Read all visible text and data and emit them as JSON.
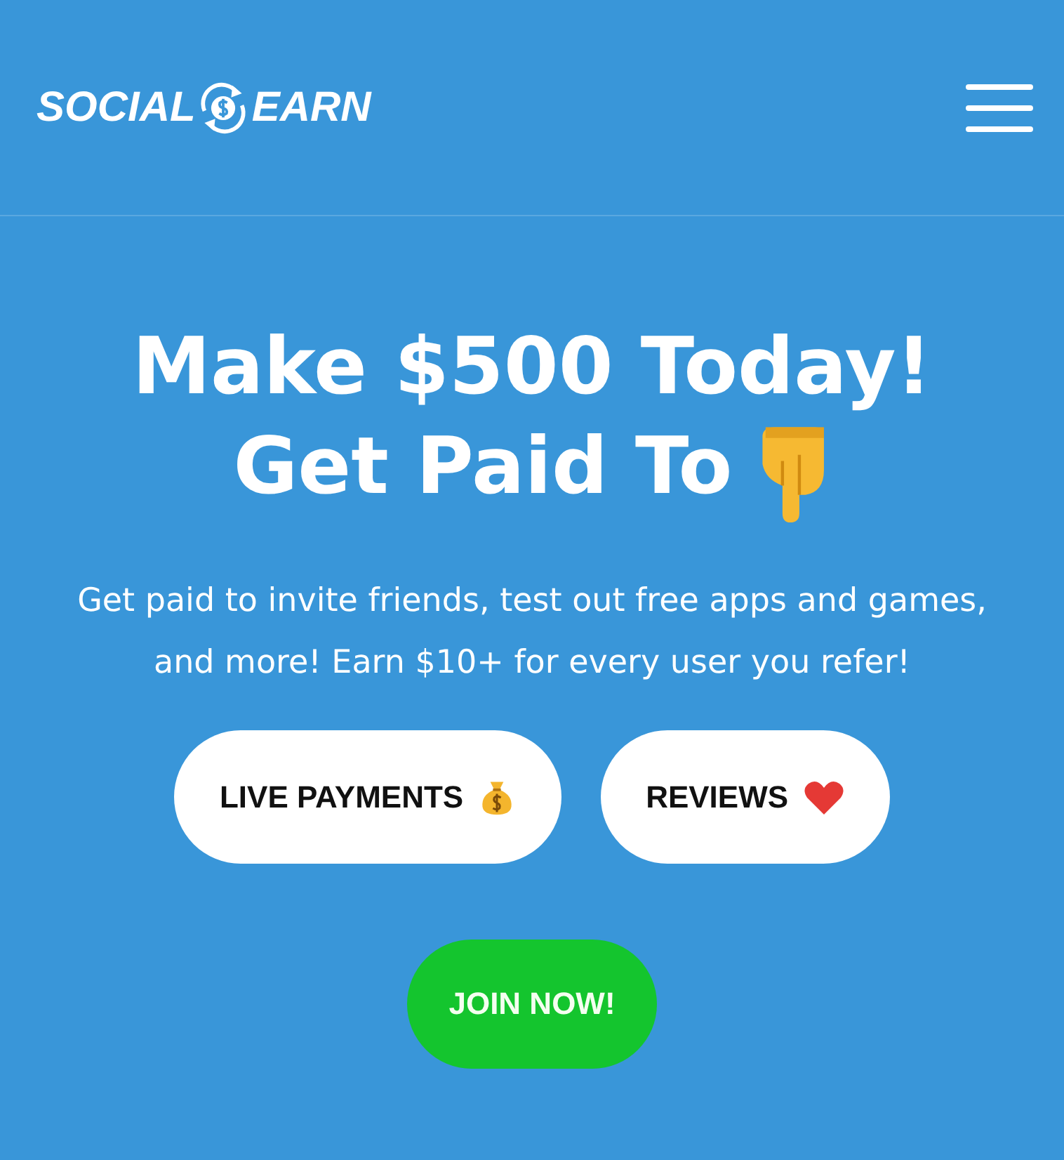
{
  "header": {
    "logo": {
      "left": "SOCIAL",
      "right": "EARN"
    }
  },
  "hero": {
    "headline": [
      "Make $500 Today!",
      "Get Paid To"
    ],
    "description": "Get paid to invite friends, test out free apps and games, and more! Earn $10+ for every user you refer!",
    "buttons": [
      {
        "label": "LIVE PAYMENTS",
        "kind": "money"
      },
      {
        "label": "REVIEWS",
        "kind": "love"
      }
    ],
    "cta": "JOIN NOW!"
  }
}
